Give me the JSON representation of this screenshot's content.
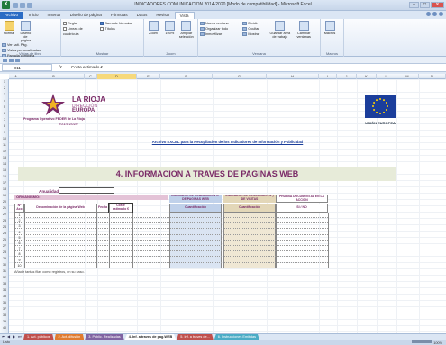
{
  "window": {
    "title": "INDICADORES COMUNICACION 2014-2020  [Modo de compatibilidad] - Microsoft Excel",
    "app_icon": "X",
    "minimize": "–",
    "maximize": "□",
    "close": "✕"
  },
  "ribbon_tabs": [
    "Archivo",
    "Inicio",
    "Insertar",
    "Diseño de página",
    "Fórmulas",
    "Datos",
    "Revisar",
    "Vista"
  ],
  "active_tab": "Vista",
  "ribbon": {
    "workbook_views": {
      "label": "Vistas de libro",
      "normal": "Normal",
      "page_layout": "Diseño de página",
      "page_break": "Ver salt. Pág.",
      "custom": "Vistas personalizadas",
      "full_screen": "Pantalla completa"
    },
    "show": {
      "label": "Mostrar",
      "ruler": "Regla",
      "formula_bar": "Barra de fórmulas",
      "gridlines": "Líneas de cuadrícula",
      "headings": "Títulos"
    },
    "zoom": {
      "label": "Zoom",
      "zoom": "Zoom",
      "hundred": "100%",
      "selection": "Ampliar selección"
    },
    "window": {
      "label": "Ventana",
      "new_window": "Nueva ventana",
      "arrange": "Organizar todo",
      "freeze": "Inmovilizar",
      "split": "Dividir",
      "hide": "Ocultar",
      "unhide": "Mostrar",
      "save_ws": "Guardar área de trabajo",
      "switch": "Cambiar ventanas"
    },
    "macros": {
      "label": "Macros",
      "macros": "Macros"
    }
  },
  "formula_bar": {
    "name_box": "D11",
    "fx": "fx",
    "content": "Coste estimado €"
  },
  "columns": [
    "A",
    "B",
    "C",
    "D",
    "E",
    "F",
    "G",
    "H",
    "I",
    "J",
    "K",
    "L",
    "M",
    "N"
  ],
  "rows": [
    "1",
    "2",
    "3",
    "4",
    "5",
    "6",
    "7",
    "8",
    "9",
    "10",
    "11",
    "12",
    "13",
    "14",
    "15",
    "16",
    "17",
    "18",
    "19",
    "20",
    "21",
    "22",
    "23",
    "24",
    "25",
    "26",
    "27",
    "28",
    "29",
    "30",
    "31",
    "32",
    "33",
    "34",
    "35",
    "36",
    "37",
    "38",
    "39",
    "40"
  ],
  "sheet": {
    "logo_lines": [
      "LA RIOJA",
      "DIRECCIÓN",
      "EUROPA",
      "Programa Operativo FEDER de La Rioja",
      "2014-2020"
    ],
    "eu_label": "UNIÓN EUROPEA",
    "archivo_heading": "Archivo EXCEL para la Recopilación de los Indicadores de Información y Publicidad",
    "main_title": "4. INFORMACION A TRAVES DE PAGINAS WEB",
    "anualidad": "Anualidad:",
    "organismo": "ORGANISMO:",
    "indicador_realizacion": "INDICADOR DE REALIZACIÓN Nº DE PAGINAS WEB",
    "indicador_resultado": "INDICADOR DE RESULTADO (Nº) DE VISITAS",
    "prueba": "PRUEBA DOCUMENTAL EN LA ACCIÓN",
    "headers": {
      "n_acc": "Nº Acc",
      "denominacion": "Denominación de la página Web",
      "fecha": "Fecha",
      "coste": "Coste estimado €",
      "cuant1": "Cuantificación",
      "cuant2": "Cuantificación",
      "si_no": "SI / NO"
    },
    "row_numbers": [
      "1",
      "2",
      "3",
      "4",
      "5",
      "6",
      "7",
      "8",
      "9",
      "10"
    ],
    "note": "Añadir tantas filas como registros, en su caso."
  },
  "sheet_tabs": [
    {
      "label": "1. Act. públicos",
      "color": "#c0504d"
    },
    {
      "label": "2. Act. difusión",
      "color": "#e07b2f"
    },
    {
      "label": "3. Public. Realizadas",
      "color": "#8064a2"
    },
    {
      "label": "4. Inf. a traves de pag.WEB",
      "color": "#ffffff",
      "active": true
    },
    {
      "label": "5. Inf. a traves de...",
      "color": "#c0504d"
    },
    {
      "label": "6. Instrucciones Emitidas",
      "color": "#4bacc6"
    }
  ],
  "status": {
    "text": "Listo",
    "zoom": "100%"
  }
}
